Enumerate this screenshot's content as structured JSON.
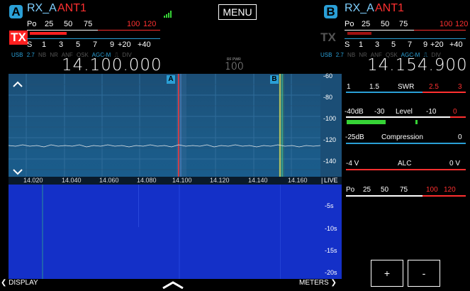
{
  "vfo_a": {
    "badge": "A",
    "rx_label": "RX_A",
    "ant_label": "ANT1",
    "tx_badge": "TX",
    "po_scale": [
      "Po",
      "25",
      "50",
      "75",
      "100",
      "120"
    ],
    "s_scale": [
      "S",
      "1",
      "3",
      "5",
      "7",
      "9",
      "+20",
      "+40"
    ],
    "mode_row": [
      "USB",
      "2.7",
      "NB",
      "NR",
      "ANF",
      "QSK",
      "AGC-M",
      "⎍",
      "DIV"
    ],
    "frequency": "14.100.000"
  },
  "vfo_b": {
    "badge": "B",
    "rx_label": "RX_A",
    "ant_label": "ANT1",
    "tx_badge": "TX",
    "po_scale": [
      "Po",
      "25",
      "50",
      "75",
      "100",
      "120"
    ],
    "s_scale": [
      "S",
      "1",
      "3",
      "5",
      "7",
      "9",
      "+20",
      "+40"
    ],
    "mode_row": [
      "USB",
      "2.7",
      "NB",
      "NR",
      "ANF",
      "QSK",
      "AGC-M",
      "⎍",
      "DIV"
    ],
    "frequency": "14.154.900"
  },
  "menu_label": "MENU",
  "rf_power": {
    "label": "RF PWR",
    "value": "100"
  },
  "spectrum": {
    "marker_a": "A",
    "marker_b": "B",
    "db_ticks": [
      "-60",
      "-80",
      "-100",
      "-120",
      "-140"
    ],
    "freq_ticks": [
      "14.020",
      "14.040",
      "14.060",
      "14.080",
      "14.100",
      "14.120",
      "14.140",
      "14.160"
    ],
    "live_label": "LIVE"
  },
  "waterfall": {
    "time_ticks": [
      "-5s",
      "-10s",
      "-15s",
      "-20s"
    ]
  },
  "bottom": {
    "display_label": "DISPLAY",
    "meters_label": "METERS"
  },
  "meters": {
    "swr": {
      "ticks": [
        "1",
        "1.5",
        "SWR",
        "2.5",
        "3"
      ]
    },
    "level": {
      "ticks": [
        "-40dB",
        "-30",
        "Level",
        "-10",
        "0"
      ]
    },
    "compression": {
      "ticks": [
        "-25dB",
        "Compression",
        "0"
      ]
    },
    "alc": {
      "ticks": [
        "-4 V",
        "ALC",
        "0 V"
      ]
    },
    "po": {
      "ticks": [
        "Po",
        "25",
        "50",
        "75",
        "100",
        "120"
      ]
    }
  },
  "buttons": {
    "plus": "+",
    "minus": "-"
  },
  "colors": {
    "accent": "#2a9fd6",
    "red": "#ff3030",
    "green": "#36d336",
    "waterfall": "#1430c8",
    "spectrum": "#1c5a86"
  }
}
